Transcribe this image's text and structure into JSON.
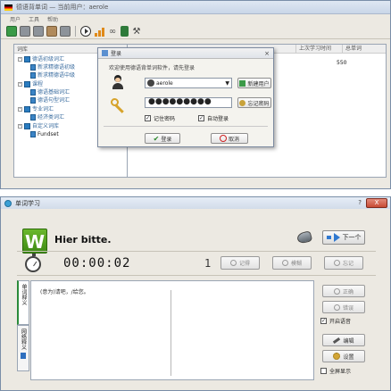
{
  "main_window": {
    "title": "德语背单词 — 当前用户：aerole",
    "menu": [
      "用户",
      "工具",
      "帮助"
    ],
    "tree": {
      "header": "词库",
      "nodes": [
        {
          "label": "德语初级词汇",
          "level": 0
        },
        {
          "label": "新求精德语初级",
          "level": 1
        },
        {
          "label": "新求精德语中级",
          "level": 1
        },
        {
          "label": "课程",
          "level": 0
        },
        {
          "label": "德语基础词汇",
          "level": 1
        },
        {
          "label": "德语句型词汇",
          "level": 1
        },
        {
          "label": "专业词汇",
          "level": 0
        },
        {
          "label": "经济类词汇",
          "level": 1
        },
        {
          "label": "自定义词库",
          "level": 0
        },
        {
          "label": "Fundset",
          "level": 1
        }
      ]
    },
    "grid": {
      "columns": [
        "上次学习时间",
        "总单词"
      ],
      "value": "550"
    }
  },
  "login_dialog": {
    "title": "登录",
    "welcome": "欢迎使用德语背单词软件，请先登录",
    "username": "aerole",
    "password_mask": "●●●●●●●●●",
    "register_label": "新建用户",
    "forgot_label": "忘记密码",
    "remember_label": "记住密码",
    "autologin_label": "自动登录",
    "login_label": "登录",
    "cancel_label": "取消"
  },
  "study_window": {
    "title": "单词学习",
    "help_label": "?",
    "close_label": "X",
    "logo_letter": "W",
    "word": "Hier bitte.",
    "next_label": "下一个",
    "timer": "00:00:02",
    "count": "1",
    "memorize_label": "记得",
    "vague_label": "模糊",
    "forget_label": "忘记",
    "tabs": [
      "单词释义",
      "网络释义"
    ],
    "meaning": "(意为)请吧，/给您。",
    "correct_label": "正确",
    "wrong_label": "错误",
    "audio_label": "开启语音",
    "edit_label": "编辑",
    "settings_label": "设置",
    "fullscreen_label": "全屏显示"
  }
}
